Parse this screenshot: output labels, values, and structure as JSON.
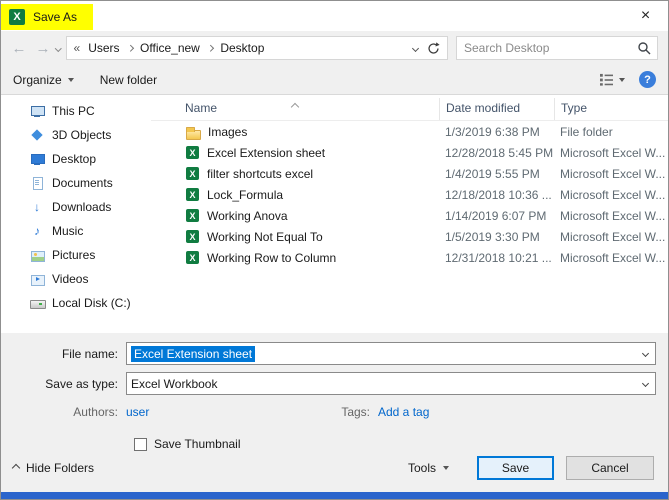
{
  "window": {
    "title": "Save As",
    "close_glyph": "×"
  },
  "colors": {
    "title_highlight": "#ffff00",
    "excel_green": "#107c41",
    "selection_blue": "#0078d7",
    "link_blue": "#0066cc",
    "default_button_border": "#0078d7",
    "bottom_strip_blue": "#2a64cc"
  },
  "nav": {
    "breadcrumb": {
      "overflow": "«",
      "items": [
        "Users",
        "Office_new",
        "Desktop"
      ]
    },
    "search": {
      "placeholder": "Search Desktop"
    }
  },
  "toolbar": {
    "organize": "Organize",
    "new_folder": "New folder"
  },
  "sidebar": {
    "items": [
      {
        "label": "This PC",
        "icon": "computer-icon"
      },
      {
        "label": "3D Objects",
        "icon": "cube-icon"
      },
      {
        "label": "Desktop",
        "icon": "desktop-icon"
      },
      {
        "label": "Documents",
        "icon": "documents-icon"
      },
      {
        "label": "Downloads",
        "icon": "downloads-icon"
      },
      {
        "label": "Music",
        "icon": "music-icon"
      },
      {
        "label": "Pictures",
        "icon": "pictures-icon"
      },
      {
        "label": "Videos",
        "icon": "videos-icon"
      },
      {
        "label": "Local Disk (C:)",
        "icon": "disk-icon"
      }
    ]
  },
  "filelist": {
    "columns": [
      "Name",
      "Date modified",
      "Type"
    ],
    "rows": [
      {
        "name": "Images",
        "date": "1/3/2019 6:38 PM",
        "type": "File folder",
        "icon": "folder-icon"
      },
      {
        "name": "Excel Extension sheet",
        "date": "12/28/2018 5:45 PM",
        "type": "Microsoft Excel W...",
        "icon": "excel-file-icon"
      },
      {
        "name": "filter shortcuts excel",
        "date": "1/4/2019 5:55 PM",
        "type": "Microsoft Excel W...",
        "icon": "excel-file-icon"
      },
      {
        "name": "Lock_Formula",
        "date": "12/18/2018 10:36 ...",
        "type": "Microsoft Excel W...",
        "icon": "excel-file-icon"
      },
      {
        "name": "Working Anova",
        "date": "1/14/2019 6:07 PM",
        "type": "Microsoft Excel W...",
        "icon": "excel-file-icon"
      },
      {
        "name": "Working Not Equal To",
        "date": "1/5/2019 3:30 PM",
        "type": "Microsoft Excel W...",
        "icon": "excel-file-icon"
      },
      {
        "name": "Working Row to Column",
        "date": "12/31/2018 10:21 ...",
        "type": "Microsoft Excel W...",
        "icon": "excel-file-icon"
      }
    ]
  },
  "fields": {
    "file_name_label": "File name:",
    "file_name_value": "Excel Extension sheet",
    "save_as_type_label": "Save as type:",
    "save_as_type_value": "Excel Workbook",
    "authors_label": "Authors:",
    "authors_value": "user",
    "tags_label": "Tags:",
    "tags_value": "Add a tag",
    "thumbnail_label": "Save Thumbnail"
  },
  "footer": {
    "hide_folders": "Hide Folders",
    "tools": "Tools",
    "save": "Save",
    "cancel": "Cancel"
  }
}
